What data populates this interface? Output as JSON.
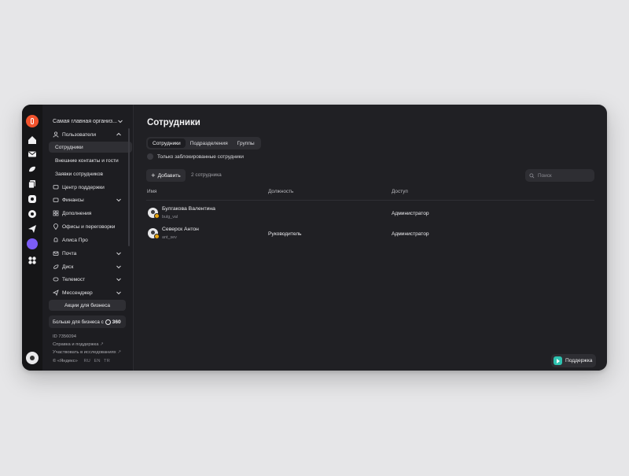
{
  "org": {
    "name": "Самая главная организ..."
  },
  "rail": {
    "icons": [
      "home-icon",
      "mail-icon",
      "disk-icon",
      "docs-icon",
      "tracker-icon",
      "telemost-icon",
      "messenger-icon",
      "alice-icon",
      "apps-icon"
    ]
  },
  "sidebar": {
    "users": "Пользователи",
    "employees": "Сотрудники",
    "external": "Внешние контакты и гости",
    "requests": "Заявки сотрудников",
    "support_center": "Центр поддержки",
    "finances": "Финансы",
    "addons": "Дополнения",
    "offices": "Офисы и переговорки",
    "alice": "Алиса Про",
    "mail": "Почта",
    "disk": "Диск",
    "telemost": "Телемост",
    "messenger": "Мессенджер",
    "promo": "Акции для бизнеса",
    "more": "Больше для бизнеса с",
    "more_brand": "360",
    "id": "ID 7356094",
    "help": "Справка и поддержка",
    "research": "Участвовать в исследованиях",
    "copyright": "© «Яндекс»",
    "langs": [
      "RU",
      "EN",
      "TR"
    ]
  },
  "main": {
    "title": "Сотрудники",
    "tabs": [
      "Сотрудники",
      "Подразделения",
      "Группы"
    ],
    "blocked_only": "Только заблокированные сотрудники",
    "add": "Добавить",
    "count": "2 сотрудника",
    "search_placeholder": "Поиск",
    "columns": {
      "name": "Имя",
      "position": "Должность",
      "access": "Доступ"
    },
    "rows": [
      {
        "name": "Булгакова Валентина",
        "login": "bulg_val",
        "position": "",
        "access": "Администратор"
      },
      {
        "name": "Северск Антон",
        "login": "ant_sev",
        "position": "Руководитель",
        "access": "Администратор"
      }
    ],
    "support": "Поддержка"
  }
}
